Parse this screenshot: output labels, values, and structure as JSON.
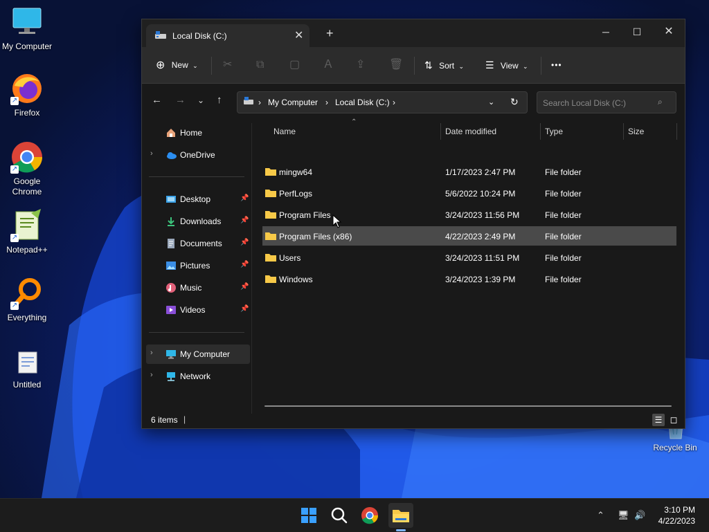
{
  "desktop": {
    "icons": [
      {
        "label": "My Computer",
        "icon": "monitor-icon"
      },
      {
        "label": "Firefox",
        "icon": "firefox-icon"
      },
      {
        "label": "Google Chrome",
        "icon": "chrome-icon"
      },
      {
        "label": "Notepad++",
        "icon": "notepadpp-icon"
      },
      {
        "label": "Everything",
        "icon": "everything-search-icon"
      },
      {
        "label": "Untitled",
        "icon": "document-icon"
      },
      {
        "label": "Recycle Bin",
        "icon": "recycle-bin-icon"
      }
    ]
  },
  "window": {
    "tab_title": "Local Disk (C:)",
    "toolbar": {
      "new_label": "New",
      "sort_label": "Sort",
      "view_label": "View",
      "more_label": "•••"
    },
    "address": {
      "crumbs": [
        "My Computer",
        "Local Disk (C:)"
      ]
    },
    "search": {
      "placeholder": "Search Local Disk (C:)"
    },
    "sidebar": {
      "home": "Home",
      "onedrive": "OneDrive",
      "quick": [
        "Desktop",
        "Downloads",
        "Documents",
        "Pictures",
        "Music",
        "Videos"
      ],
      "my_computer": "My Computer",
      "network": "Network"
    },
    "columns": {
      "name": "Name",
      "date": "Date modified",
      "type": "Type",
      "size": "Size"
    },
    "rows": [
      {
        "name": "mingw64",
        "date": "1/17/2023 2:47 PM",
        "type": "File folder"
      },
      {
        "name": "PerfLogs",
        "date": "5/6/2022 10:24 PM",
        "type": "File folder"
      },
      {
        "name": "Program Files",
        "date": "3/24/2023 11:56 PM",
        "type": "File folder"
      },
      {
        "name": "Program Files (x86)",
        "date": "4/22/2023 2:49 PM",
        "type": "File folder"
      },
      {
        "name": "Users",
        "date": "3/24/2023 11:51 PM",
        "type": "File folder"
      },
      {
        "name": "Windows",
        "date": "3/24/2023 1:39 PM",
        "type": "File folder"
      }
    ],
    "status": "6 items"
  },
  "taskbar": {
    "time": "3:10 PM",
    "date": "4/22/2023"
  },
  "colors": {
    "accent": "#7cb4ff",
    "folder": "#f7c948",
    "window_bg": "#191919"
  }
}
